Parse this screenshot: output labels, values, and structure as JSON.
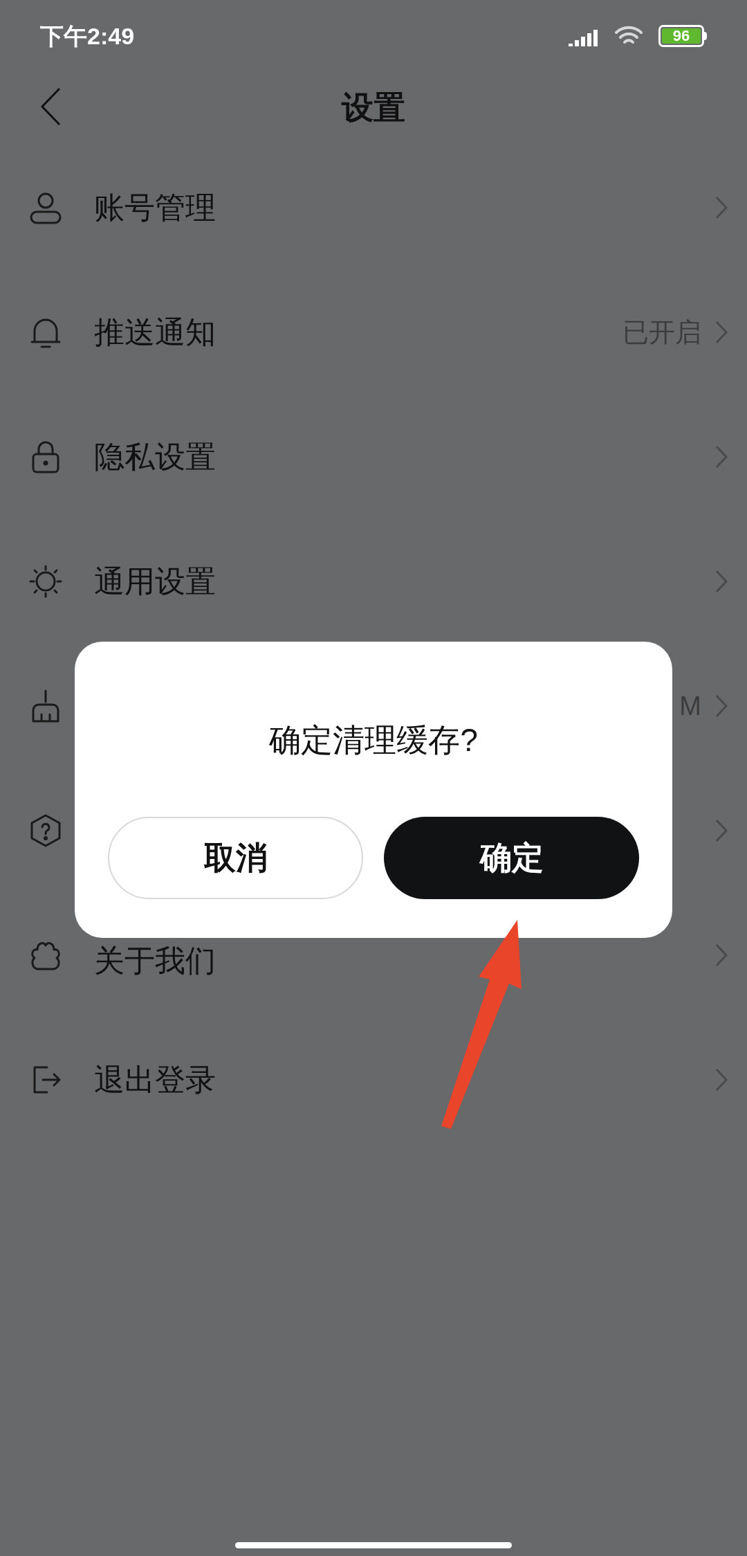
{
  "status_bar": {
    "time": "下午2:49",
    "battery": "96"
  },
  "header": {
    "title": "设置"
  },
  "settings": [
    {
      "label": "账号管理",
      "chevron": true
    },
    {
      "label": "推送通知",
      "value": "已开启",
      "chevron": true
    },
    {
      "label": "隐私设置",
      "chevron": true
    },
    {
      "label": "通用设置",
      "chevron": true
    },
    {
      "value": "M",
      "chevron": true
    },
    {
      "chevron": true
    },
    {
      "label": "关于我们",
      "chevron": true
    },
    {
      "label": "退出登录",
      "chevron": true
    }
  ],
  "dialog": {
    "message": "确定清理缓存?",
    "buttons": [
      {
        "label": "取消",
        "kind": "secondary"
      },
      {
        "label": "确定",
        "kind": "primary"
      }
    ]
  }
}
